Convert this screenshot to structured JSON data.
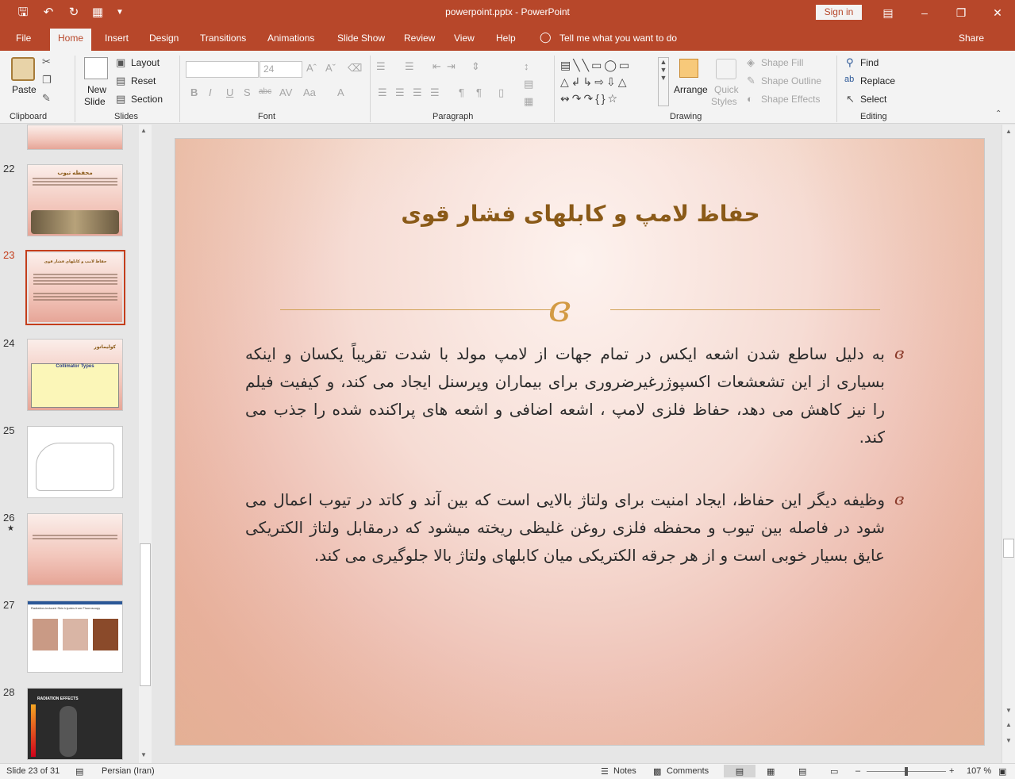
{
  "window": {
    "doc_title": "powerpoint.pptx  -  PowerPoint",
    "sign_in": "Sign in"
  },
  "tabs": [
    "File",
    "Home",
    "Insert",
    "Design",
    "Transitions",
    "Animations",
    "Slide Show",
    "Review",
    "View",
    "Help"
  ],
  "tell_me": "Tell me what you want to do",
  "share": "Share",
  "ribbon": {
    "clipboard": {
      "label": "Clipboard",
      "paste": "Paste"
    },
    "slides": {
      "label": "Slides",
      "new_slide_1": "New",
      "new_slide_2": "Slide",
      "layout": "Layout",
      "reset": "Reset",
      "section": "Section"
    },
    "font": {
      "label": "Font",
      "size": "24"
    },
    "paragraph": {
      "label": "Paragraph"
    },
    "drawing": {
      "label": "Drawing",
      "arrange": "Arrange",
      "quick_styles_1": "Quick",
      "quick_styles_2": "Styles",
      "shape_fill": "Shape Fill",
      "shape_outline": "Shape Outline",
      "shape_effects": "Shape Effects"
    },
    "editing": {
      "label": "Editing",
      "find": "Find",
      "replace": "Replace",
      "select": "Select"
    }
  },
  "thumbnails": [
    {
      "num": "22",
      "title": "محفظه تیوب"
    },
    {
      "num": "23",
      "title": "حفاظ لامپ و کابلهای فشار قوی"
    },
    {
      "num": "24",
      "title": "کولیماتور",
      "subtitle": "Collimator Types"
    },
    {
      "num": "25",
      "title": ""
    },
    {
      "num": "26",
      "title": "",
      "star": "★"
    },
    {
      "num": "27",
      "title": "Radiation-induced Skin Injuries from Fluoroscopy"
    },
    {
      "num": "28",
      "title": "RADIATION EFFECTS"
    }
  ],
  "slide": {
    "title": "حفاظ لامپ و کابلهای فشار قوی",
    "ornament": "ɞ",
    "bullet": "ɞ",
    "paragraph1": "به دلیل ساطع شدن اشعه ایکس در تمام جهات از لامپ مولد با شدت تقریباً یکسان و اینکه بسیاری از این تشعشعات اکسپوژرغیرضروری برای بیماران وپرسنل ایجاد می کند، و کیفیت فیلم را نیز کاهش می دهد، حفاظ فلزی لامپ ، اشعه اضافی و اشعه های پراکنده شده را جذب می کند.",
    "paragraph2": "وظیفه دیگر این حفاظ، ایجاد امنیت برای ولتاژ بالایی است که بین آند و کاتد در تیوب اعمال می شود در فاصله بین تیوب و محفظه فلزی روغن غلیظی ریخته میشود که درمقابل ولتاژ الکتریکی عایق بسیار خوبی است و از هر جرقه الکتریکی میان کابلهای ولتاژ بالا جلوگیری می کند."
  },
  "status": {
    "slide_of": "Slide 23 of 31",
    "language": "Persian (Iran)",
    "notes": "Notes",
    "comments": "Comments",
    "zoom": "107 %"
  },
  "colors": {
    "accent": "#b7472a",
    "title": "#8a5a18",
    "ornament": "#d39a44"
  }
}
